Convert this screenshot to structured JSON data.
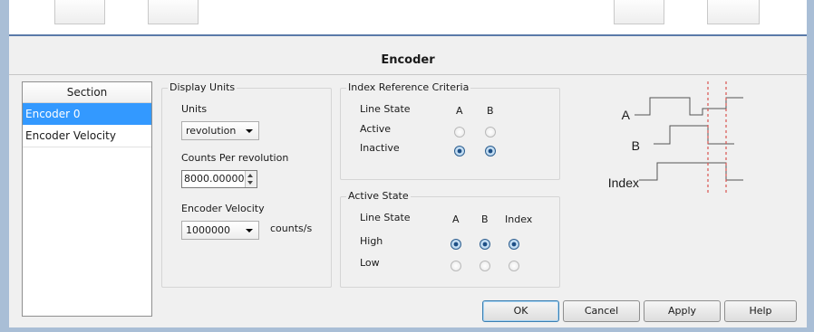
{
  "dialog": {
    "title": "Encoder"
  },
  "sidebar": {
    "header": "Section",
    "items": [
      {
        "label": "Encoder 0",
        "selected": true
      },
      {
        "label": "Encoder Velocity",
        "selected": false
      }
    ]
  },
  "display_units": {
    "group_title": "Display Units",
    "units_label": "Units",
    "units_value": "revolution",
    "counts_label": "Counts Per revolution",
    "counts_value": "8000.000000",
    "velocity_label": "Encoder Velocity",
    "velocity_value": "1000000",
    "velocity_unit": "counts/s"
  },
  "index_reference": {
    "group_title": "Index Reference Criteria",
    "header_line_state": "Line State",
    "header_a": "A",
    "header_b": "B",
    "rows": [
      {
        "label": "Active",
        "a": false,
        "b": false
      },
      {
        "label": "Inactive",
        "a": true,
        "b": true
      }
    ]
  },
  "active_state": {
    "group_title": "Active State",
    "header_line_state": "Line State",
    "header_a": "A",
    "header_b": "B",
    "header_index": "Index",
    "rows": [
      {
        "label": "High",
        "a": true,
        "b": true,
        "index": true
      },
      {
        "label": "Low",
        "a": false,
        "b": false,
        "index": false
      }
    ]
  },
  "diagram": {
    "label_a": "A",
    "label_b": "B",
    "label_index": "Index",
    "signal_color": "#555555",
    "marker_color": "#d9534f"
  },
  "buttons": {
    "ok": "OK",
    "cancel": "Cancel",
    "apply": "Apply",
    "help": "Help"
  }
}
